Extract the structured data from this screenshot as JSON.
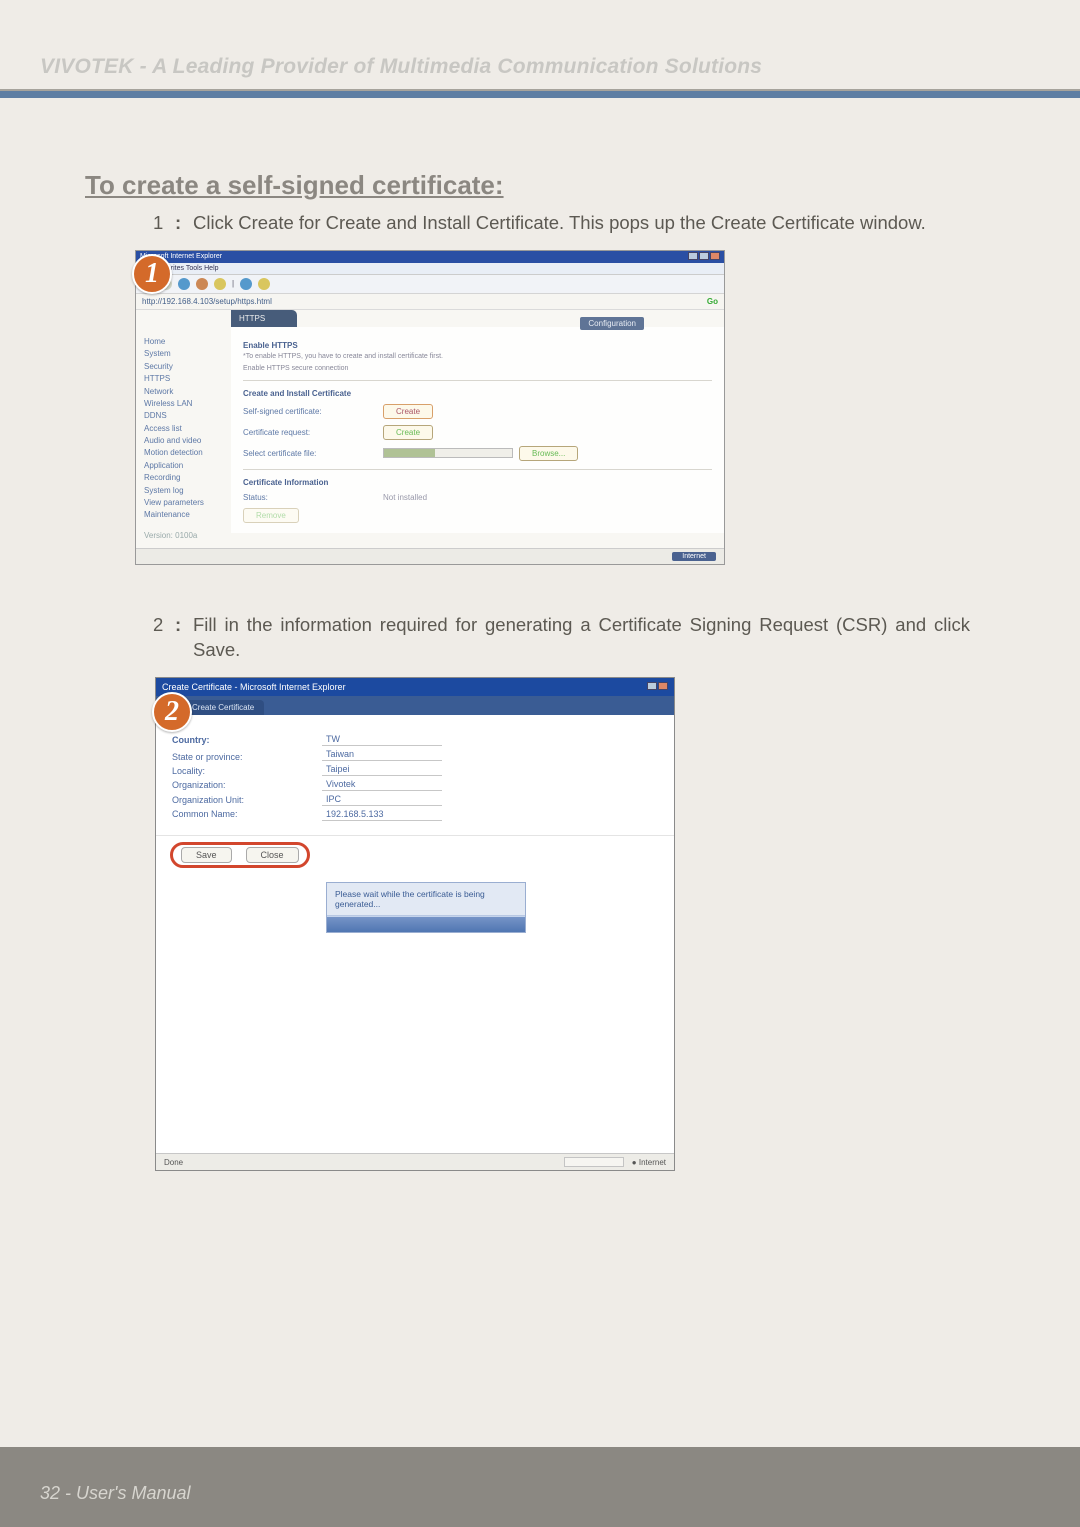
{
  "header": {
    "brandline": "VIVOTEK - A Leading Provider of Multimedia Communication Solutions"
  },
  "section_title": "To create a self-signed certificate:",
  "steps": {
    "s1": {
      "num": "1",
      "colon": ":",
      "text": "Click Create for Create and Install Certificate. This pops up the Create Certificate window."
    },
    "s2": {
      "num": "2",
      "colon": ":",
      "text": "Fill in the information required for generating a Certificate Signing Request (CSR) and click Save."
    }
  },
  "shot1": {
    "badge": "1",
    "titlebar": "Microsoft Internet Explorer",
    "menubar": "File   Favorites   Tools   Help",
    "urlbar": "http://192.168.4.103/setup/https.html",
    "go": "Go",
    "cfg": "Configuration",
    "tab": "HTTPS",
    "sidebar": [
      "Home",
      "System",
      "Security",
      "HTTPS",
      "Network",
      "Wireless LAN",
      "DDNS",
      "Access list",
      "Audio and video",
      "Motion detection",
      "Application",
      "Recording",
      "System log",
      "View parameters",
      "Maintenance",
      "Version: 0100a"
    ],
    "p1_title": "Enable HTTPS",
    "p1_hint1": "*To enable HTTPS, you have to create and install certificate first.",
    "p1_hint2": "Enable HTTPS secure connection",
    "p2_title": "Create and Install Certificate",
    "r1_lbl": "Self-signed certificate:",
    "r1_btn": "Create",
    "r2_lbl": "Certificate request:",
    "r2_btn": "Create",
    "r3_lbl": "Select certificate file:",
    "r3_btn": "Browse...",
    "p3_title": "Certificate Information",
    "r4_lbl": "Status:",
    "r4_val": "Not installed",
    "remove": "Remove",
    "status_chip": "Internet"
  },
  "shot2": {
    "badge": "2",
    "titlebar": "Create Certificate - Microsoft Internet Explorer",
    "tab": "Create Certificate",
    "form_labels": [
      "Country:",
      "State or province:",
      "Locality:",
      "Organization:",
      "Organization Unit:",
      "Common Name:"
    ],
    "form_values": [
      "TW",
      "Taiwan",
      "Taipei",
      "Vivotek",
      "IPC",
      "192.168.5.133"
    ],
    "save": "Save",
    "close": "Close",
    "dialog_msg": "Please wait while the certificate is being generated...",
    "status_left": "Done",
    "status_right": "Internet"
  },
  "footer": {
    "text": "32 - User's Manual"
  }
}
